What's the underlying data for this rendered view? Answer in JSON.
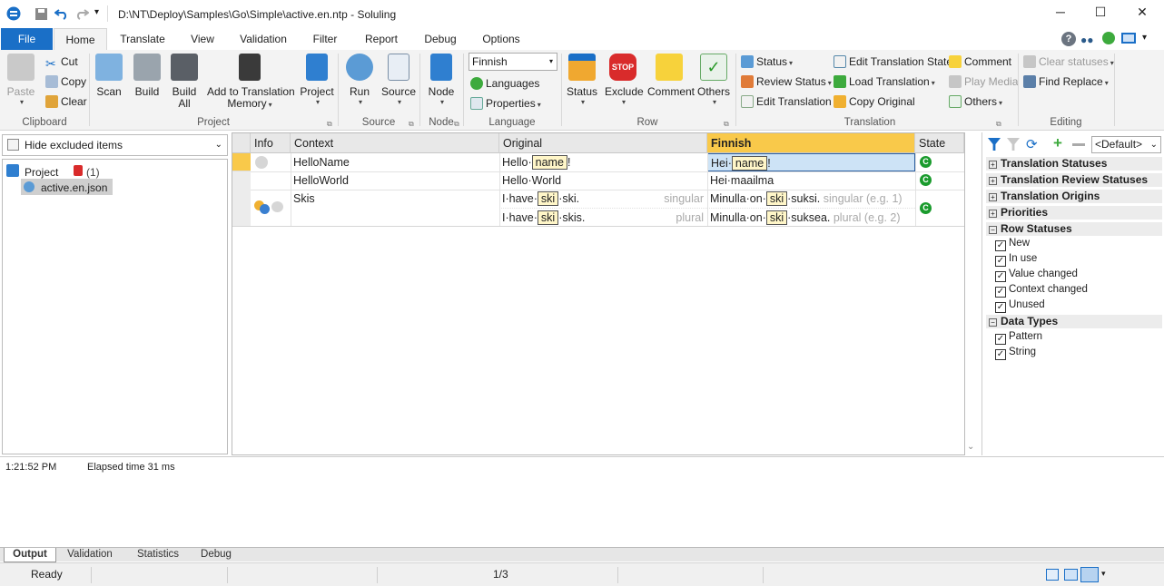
{
  "window": {
    "title": "D:\\NT\\Deploy\\Samples\\Go\\Simple\\active.en.ntp  -  Soluling"
  },
  "ribbon_tabs": [
    "File",
    "Home",
    "Translate",
    "View",
    "Validation",
    "Filter",
    "Report",
    "Debug",
    "Options"
  ],
  "clipboard": {
    "paste": "Paste",
    "cut": "Cut",
    "copy": "Copy",
    "clear": "Clear",
    "group": "Clipboard"
  },
  "project": {
    "scan": "Scan",
    "build": "Build",
    "build_all": "Build All",
    "add_tm_1": "Add to Translation",
    "add_tm_2": "Memory",
    "project": "Project",
    "group": "Project"
  },
  "source": {
    "run": "Run",
    "source": "Source",
    "group": "Source"
  },
  "node": {
    "node": "Node",
    "group": "Node"
  },
  "language": {
    "selected": "Finnish",
    "languages": "Languages",
    "properties": "Properties",
    "group": "Language"
  },
  "row": {
    "status": "Status",
    "exclude": "Exclude",
    "comment": "Comment",
    "others": "Others",
    "group": "Row"
  },
  "translation": {
    "status": "Status",
    "review_status": "Review Status",
    "edit_translation": "Edit Translation",
    "edit_translation_state": "Edit Translation State",
    "load_translation": "Load Translation",
    "copy_original": "Copy Original",
    "comment": "Comment",
    "play_media": "Play Media",
    "others": "Others",
    "group": "Translation"
  },
  "editing": {
    "clear_statuses": "Clear statuses",
    "find_replace": "Find Replace",
    "group": "Editing"
  },
  "left": {
    "filter": "Hide excluded items",
    "tree_project": "Project",
    "tree_count": "(1)",
    "tree_file": "active.en.json"
  },
  "grid": {
    "headers": {
      "info": "Info",
      "context": "Context",
      "original": "Original",
      "finnish": "Finnish",
      "state": "State"
    },
    "rows": [
      {
        "context": "HelloName",
        "orig_pre": "Hello·",
        "orig_pill": "name",
        "orig_post": "!",
        "fin_pre": "Hei·",
        "fin_pill": "name",
        "fin_post": "!",
        "state": "C"
      },
      {
        "context": "HelloWorld",
        "original": "Hello·World",
        "finnish": "Hei·maailma",
        "state": "C"
      },
      {
        "context": "Skis",
        "orig1_pre": "I·have·",
        "orig1_pill": "ski",
        "orig1_post": "·ski.",
        "orig1_hint": "singular",
        "orig2_pre": "I·have·",
        "orig2_pill": "ski",
        "orig2_post": "·skis.",
        "orig2_hint": "plural",
        "fin1_pre": "Minulla·on·",
        "fin1_pill": "ski",
        "fin1_post": "·suksi.",
        "fin1_hint": "singular (e.g. 1)",
        "fin2_pre": "Minulla·on·",
        "fin2_pill": "ski",
        "fin2_post": "·suksea.",
        "fin2_hint": "plural (e.g. 2)",
        "state": "C"
      }
    ]
  },
  "right": {
    "preset": "<Default>",
    "sections": [
      "Translation Statuses",
      "Translation Review Statuses",
      "Translation Origins",
      "Priorities",
      "Row Statuses",
      "Data Types"
    ],
    "row_statuses": [
      "New",
      "In use",
      "Value changed",
      "Context changed",
      "Unused"
    ],
    "data_types": [
      "Pattern",
      "String"
    ]
  },
  "output": {
    "time": "1:21:52 PM",
    "message": "Elapsed time 31 ms"
  },
  "output_tabs": [
    "Output",
    "Validation",
    "Statistics",
    "Debug"
  ],
  "status": {
    "ready": "Ready",
    "position": "1/3"
  },
  "colors": {
    "accent": "#1a6fc7",
    "finnish_header": "#f9c94a",
    "state_ok": "#1a9b2d"
  }
}
